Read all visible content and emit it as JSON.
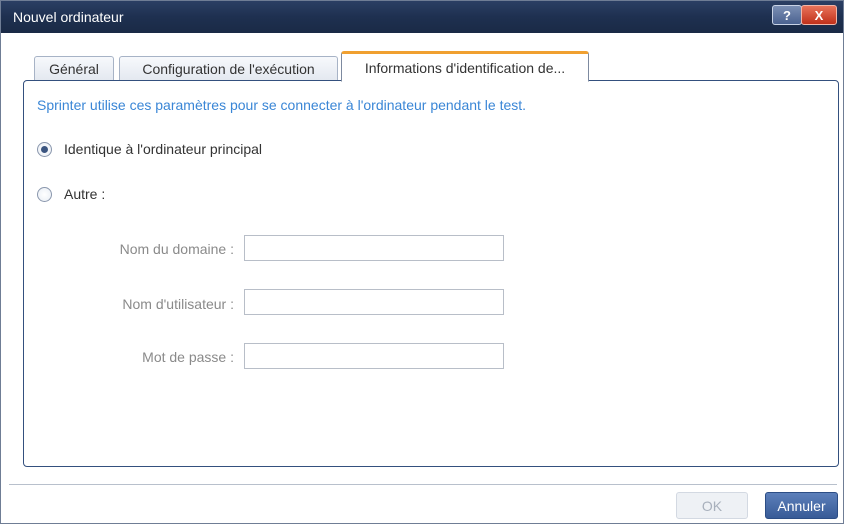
{
  "window": {
    "title": "Nouvel ordinateur",
    "help_label": "?",
    "close_label": "X"
  },
  "tabs": [
    {
      "label": "Général",
      "active": false
    },
    {
      "label": "Configuration de l'exécution",
      "active": false
    },
    {
      "label": "Informations d'identification de...",
      "active": true
    }
  ],
  "panel": {
    "intro": "Sprinter utilise ces paramètres pour se connecter à l'ordinateur pendant le test.",
    "options": [
      {
        "label": "Identique à l'ordinateur principal",
        "selected": true
      },
      {
        "label": "Autre :",
        "selected": false
      }
    ],
    "fields": [
      {
        "label": "Nom du domaine :",
        "value": ""
      },
      {
        "label": "Nom d'utilisateur :",
        "value": ""
      },
      {
        "label": "Mot de passe :",
        "value": ""
      }
    ]
  },
  "footer": {
    "ok_label": "OK",
    "cancel_label": "Annuler"
  },
  "colors": {
    "accent_text": "#3a86d6",
    "active_tab_highlight": "#f0a030",
    "titlebar": "#1e3050"
  }
}
